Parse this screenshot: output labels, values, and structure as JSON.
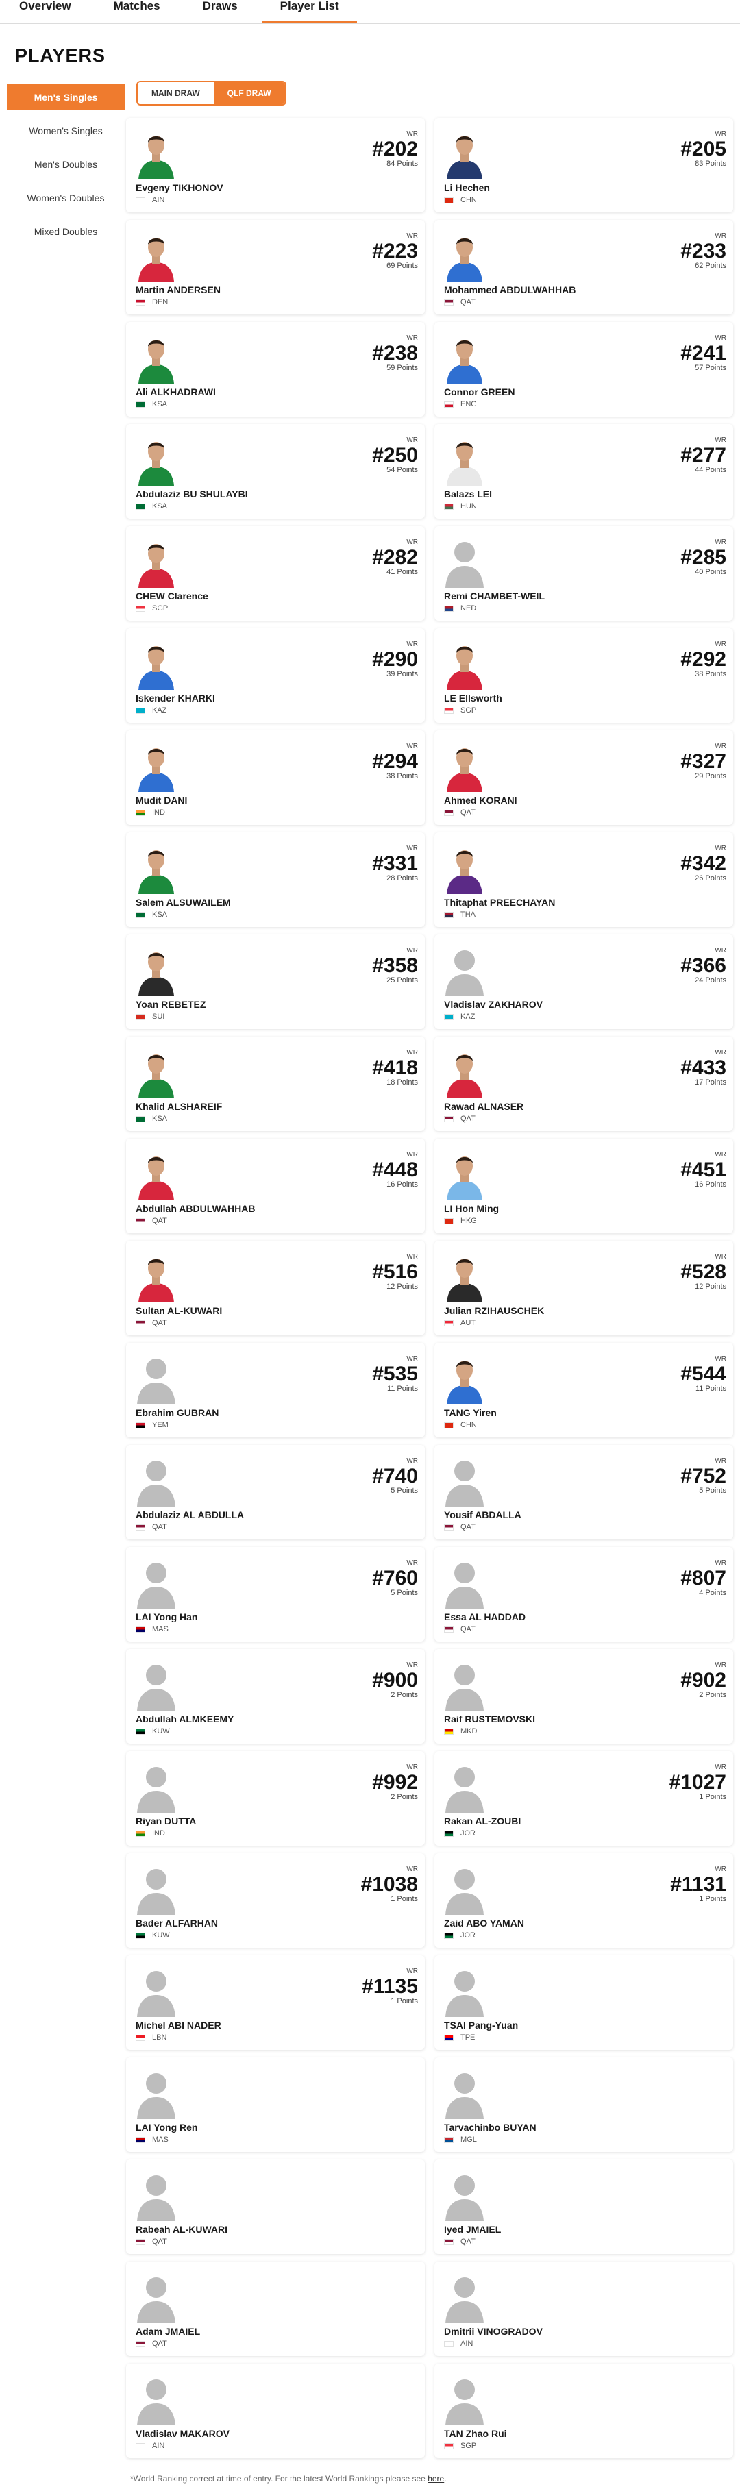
{
  "nav": {
    "tabs": [
      {
        "label": "Overview",
        "active": false
      },
      {
        "label": "Matches",
        "active": false
      },
      {
        "label": "Draws",
        "active": false
      },
      {
        "label": "Player List",
        "active": true
      }
    ]
  },
  "page_title": "PLAYERS",
  "sidebar": {
    "items": [
      {
        "label": "Men's Singles",
        "active": true
      },
      {
        "label": "Women's Singles",
        "active": false
      },
      {
        "label": "Men's Doubles",
        "active": false
      },
      {
        "label": "Women's Doubles",
        "active": false
      },
      {
        "label": "Mixed Doubles",
        "active": false
      }
    ]
  },
  "draw_toggle": {
    "main": "MAIN DRAW",
    "qlf": "QLF DRAW",
    "selected": "qlf"
  },
  "wr_label": "WR",
  "points_label": "Points",
  "accent_color": "#ef7b2e",
  "players": [
    {
      "name": "Evgeny TIKHONOV",
      "country": "AIN",
      "rank": "#202",
      "points": "84",
      "photo": "green"
    },
    {
      "name": "Li Hechen",
      "country": "CHN",
      "rank": "#205",
      "points": "83",
      "photo": "navy"
    },
    {
      "name": "Martin ANDERSEN",
      "country": "DEN",
      "rank": "#223",
      "points": "69",
      "photo": "red"
    },
    {
      "name": "Mohammed ABDULWAHHAB",
      "country": "QAT",
      "rank": "#233",
      "points": "62",
      "photo": "blue"
    },
    {
      "name": "Ali ALKHADRAWI",
      "country": "KSA",
      "rank": "#238",
      "points": "59",
      "photo": "green"
    },
    {
      "name": "Connor GREEN",
      "country": "ENG",
      "rank": "#241",
      "points": "57",
      "photo": "blue"
    },
    {
      "name": "Abdulaziz BU SHULAYBI",
      "country": "KSA",
      "rank": "#250",
      "points": "54",
      "photo": "green"
    },
    {
      "name": "Balazs LEI",
      "country": "HUN",
      "rank": "#277",
      "points": "44",
      "photo": "white"
    },
    {
      "name": "CHEW Clarence",
      "country": "SGP",
      "rank": "#282",
      "points": "41",
      "photo": "red"
    },
    {
      "name": "Remi CHAMBET-WEIL",
      "country": "NED",
      "rank": "#285",
      "points": "40",
      "photo": "none"
    },
    {
      "name": "Iskender KHARKI",
      "country": "KAZ",
      "rank": "#290",
      "points": "39",
      "photo": "blue"
    },
    {
      "name": "LE Ellsworth",
      "country": "SGP",
      "rank": "#292",
      "points": "38",
      "photo": "red"
    },
    {
      "name": "Mudit DANI",
      "country": "IND",
      "rank": "#294",
      "points": "38",
      "photo": "blue"
    },
    {
      "name": "Ahmed KORANI",
      "country": "QAT",
      "rank": "#327",
      "points": "29",
      "photo": "red"
    },
    {
      "name": "Salem ALSUWAILEM",
      "country": "KSA",
      "rank": "#331",
      "points": "28",
      "photo": "green"
    },
    {
      "name": "Thitaphat PREECHAYAN",
      "country": "THA",
      "rank": "#342",
      "points": "26",
      "photo": "purple"
    },
    {
      "name": "Yoan REBETEZ",
      "country": "SUI",
      "rank": "#358",
      "points": "25",
      "photo": "black"
    },
    {
      "name": "Vladislav ZAKHAROV",
      "country": "KAZ",
      "rank": "#366",
      "points": "24",
      "photo": "none"
    },
    {
      "name": "Khalid ALSHAREIF",
      "country": "KSA",
      "rank": "#418",
      "points": "18",
      "photo": "green"
    },
    {
      "name": "Rawad ALNASER",
      "country": "QAT",
      "rank": "#433",
      "points": "17",
      "photo": "red"
    },
    {
      "name": "Abdullah ABDULWAHHAB",
      "country": "QAT",
      "rank": "#448",
      "points": "16",
      "photo": "red"
    },
    {
      "name": "LI Hon Ming",
      "country": "HKG",
      "rank": "#451",
      "points": "16",
      "photo": "lightblue"
    },
    {
      "name": "Sultan AL-KUWARI",
      "country": "QAT",
      "rank": "#516",
      "points": "12",
      "photo": "red"
    },
    {
      "name": "Julian RZIHAUSCHEK",
      "country": "AUT",
      "rank": "#528",
      "points": "12",
      "photo": "black"
    },
    {
      "name": "Ebrahim GUBRAN",
      "country": "YEM",
      "rank": "#535",
      "points": "11",
      "photo": "none"
    },
    {
      "name": "TANG Yiren",
      "country": "CHN",
      "rank": "#544",
      "points": "11",
      "photo": "blue"
    },
    {
      "name": "Abdulaziz AL ABDULLA",
      "country": "QAT",
      "rank": "#740",
      "points": "5",
      "photo": "none"
    },
    {
      "name": "Yousif ABDALLA",
      "country": "QAT",
      "rank": "#752",
      "points": "5",
      "photo": "none"
    },
    {
      "name": "LAI Yong Han",
      "country": "MAS",
      "rank": "#760",
      "points": "5",
      "photo": "none"
    },
    {
      "name": "Essa AL HADDAD",
      "country": "QAT",
      "rank": "#807",
      "points": "4",
      "photo": "none"
    },
    {
      "name": "Abdullah ALMKEEMY",
      "country": "KUW",
      "rank": "#900",
      "points": "2",
      "photo": "none"
    },
    {
      "name": "Raif RUSTEMOVSKI",
      "country": "MKD",
      "rank": "#902",
      "points": "2",
      "photo": "none"
    },
    {
      "name": "Riyan DUTTA",
      "country": "IND",
      "rank": "#992",
      "points": "2",
      "photo": "none"
    },
    {
      "name": "Rakan AL-ZOUBI",
      "country": "JOR",
      "rank": "#1027",
      "points": "1",
      "photo": "none"
    },
    {
      "name": "Bader ALFARHAN",
      "country": "KUW",
      "rank": "#1038",
      "points": "1",
      "photo": "none"
    },
    {
      "name": "Zaid ABO YAMAN",
      "country": "JOR",
      "rank": "#1131",
      "points": "1",
      "photo": "none"
    },
    {
      "name": "Michel ABI NADER",
      "country": "LBN",
      "rank": "#1135",
      "points": "1",
      "photo": "none"
    },
    {
      "name": "TSAI Pang-Yuan",
      "country": "TPE",
      "rank": "",
      "points": "",
      "photo": "none"
    },
    {
      "name": "LAI Yong Ren",
      "country": "MAS",
      "rank": "",
      "points": "",
      "photo": "none"
    },
    {
      "name": "Tarvachinbo BUYAN",
      "country": "MGL",
      "rank": "",
      "points": "",
      "photo": "none"
    },
    {
      "name": "Rabeah AL-KUWARI",
      "country": "QAT",
      "rank": "",
      "points": "",
      "photo": "none"
    },
    {
      "name": "Iyed JMAIEL",
      "country": "QAT",
      "rank": "",
      "points": "",
      "photo": "none"
    },
    {
      "name": "Adam JMAIEL",
      "country": "QAT",
      "rank": "",
      "points": "",
      "photo": "none"
    },
    {
      "name": "Dmitrii VINOGRADOV",
      "country": "AIN",
      "rank": "",
      "points": "",
      "photo": "none"
    },
    {
      "name": "Vladislav MAKAROV",
      "country": "AIN",
      "rank": "",
      "points": "",
      "photo": "none"
    },
    {
      "name": "TAN Zhao Rui",
      "country": "SGP",
      "rank": "",
      "points": "",
      "photo": "none"
    }
  ],
  "footnote": {
    "text": "*World Ranking correct at time of entry. For the latest World Rankings please see ",
    "link": "here",
    "end": "."
  }
}
